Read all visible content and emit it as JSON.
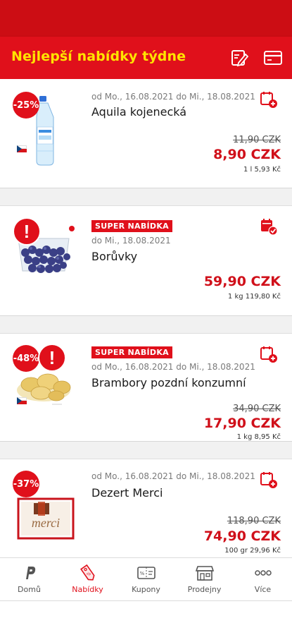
{
  "header": {
    "title": "Nejlepší nabídky týdne",
    "icons": [
      "shopping-list-icon",
      "card-icon"
    ]
  },
  "offers": [
    {
      "discount": "-25%",
      "badge": "",
      "date": "od Mo., 16.08.2021 do Mi., 18.08.2021",
      "name": "Aquila kojenecká",
      "old_price": "11,90 CZK",
      "price": "8,90 CZK",
      "unit_price": "1 l 5,93 Kč",
      "action_icon": "add-to-calendar-icon"
    },
    {
      "discount": "",
      "badge": "SUPER NABÍDKA",
      "date": "do Mi., 18.08.2021",
      "name": "Borůvky",
      "old_price": "",
      "price": "59,90 CZK",
      "unit_price": "1 kg 119,80 Kč",
      "action_icon": "calendar-check-icon"
    },
    {
      "discount": "-48%",
      "badge": "SUPER NABÍDKA",
      "date": "od Mo., 16.08.2021 do Mi., 18.08.2021",
      "name": "Brambory pozdní konzumní",
      "old_price": "34,90 CZK",
      "price": "17,90 CZK",
      "unit_price": "1 kg 8,95 Kč",
      "action_icon": "add-to-calendar-icon"
    },
    {
      "discount": "-37%",
      "badge": "",
      "date": "od Mo., 16.08.2021 do Mi., 18.08.2021",
      "name": "Dezert Merci",
      "old_price": "118,90 CZK",
      "price": "74,90 CZK",
      "unit_price": "100 gr 29,96 Kč",
      "action_icon": "add-to-calendar-icon"
    }
  ],
  "product_image_text": {
    "merci": "merci"
  },
  "bottom_nav": {
    "items": [
      {
        "label": "Domů",
        "icon": "home-p-icon",
        "active": false
      },
      {
        "label": "Nabídky",
        "icon": "price-tag-icon",
        "active": true
      },
      {
        "label": "Kupony",
        "icon": "coupon-icon",
        "active": false
      },
      {
        "label": "Prodejny",
        "icon": "store-icon",
        "active": false
      },
      {
        "label": "Více",
        "icon": "more-icon",
        "active": false
      }
    ]
  },
  "colors": {
    "brand_red": "#e0101b",
    "status_red": "#cc0d14",
    "title_yellow": "#ffe400",
    "price_red": "#d0101a"
  }
}
